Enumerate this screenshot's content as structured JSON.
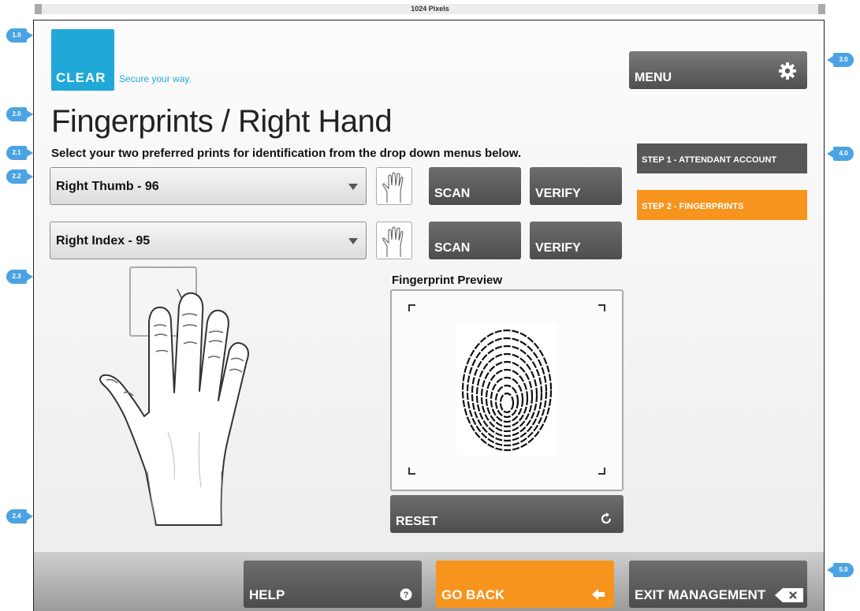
{
  "ruler": {
    "label": "1024 Pixels"
  },
  "annotations": [
    "1.0",
    "2.0",
    "2.1",
    "2.2",
    "2.3",
    "2.4",
    "3.0",
    "4.0",
    "5.0"
  ],
  "logo": {
    "text": "CLEAR",
    "tagline": "Secure your way."
  },
  "menu": {
    "label": "MENU",
    "icon": "gear-icon"
  },
  "page": {
    "title": "Fingerprints / Right Hand",
    "instructions": "Select your two preferred prints for identification from the drop down menus below."
  },
  "finger_rows": [
    {
      "selected": "Right Thumb - 96",
      "scan_label": "SCAN",
      "verify_label": "VERIFY"
    },
    {
      "selected": "Right Index - 95",
      "scan_label": "SCAN",
      "verify_label": "VERIFY"
    }
  ],
  "steps": [
    {
      "label": "STEP 1 - ATTENDANT ACCOUNT",
      "active": false
    },
    {
      "label": "STEP 2 - FINGERPRINTS",
      "active": true
    }
  ],
  "preview": {
    "label": "Fingerprint Preview",
    "reset_label": "RESET",
    "reset_icon": "refresh-icon"
  },
  "footer": {
    "help_label": "HELP",
    "help_icon": "question-icon",
    "goback_label": "GO BACK",
    "goback_icon": "arrow-left-icon",
    "exit_label": "EXIT MANAGEMENT",
    "exit_icon": "backspace-icon"
  },
  "colors": {
    "accent": "#f7941d",
    "dark_button": "#575757",
    "brand": "#20a8d8",
    "annotation": "#4ba3e3"
  }
}
